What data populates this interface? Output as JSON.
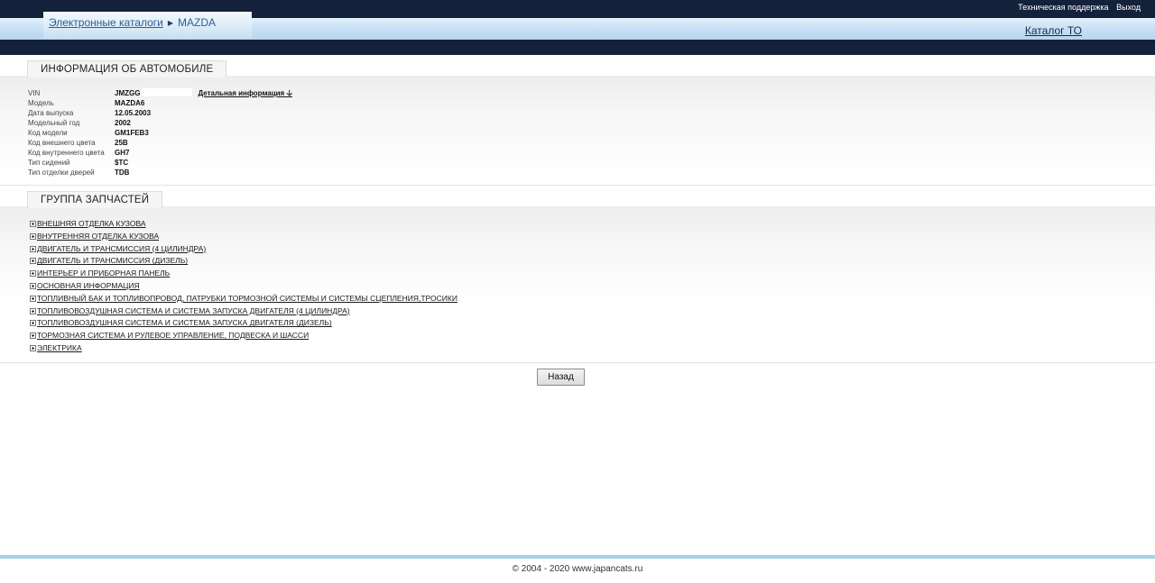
{
  "header": {
    "support_label": "Техническая поддержка",
    "logout_label": "Выход",
    "breadcrumb": {
      "root": "Электронные каталоги",
      "current": "MAZDA"
    },
    "to_catalog_label": "Каталог ТО"
  },
  "vehicle_info": {
    "title": "ИНФОРМАЦИЯ ОБ АВТОМОБИЛЕ",
    "detail_link": "Детальная информация",
    "rows": [
      {
        "label": "VIN",
        "value": "JMZGG"
      },
      {
        "label": "Модель",
        "value": "MAZDA6"
      },
      {
        "label": "Дата выпуска",
        "value": "12.05.2003"
      },
      {
        "label": "Модельный год",
        "value": "2002"
      },
      {
        "label": "Код модели",
        "value": "GM1FEB3"
      },
      {
        "label": "Код внешнего цвета",
        "value": "25B"
      },
      {
        "label": "Код внутреннего цвета",
        "value": "GH7"
      },
      {
        "label": "Тип сидений",
        "value": "$TC"
      },
      {
        "label": "Тип отделки дверей",
        "value": "TDB"
      }
    ]
  },
  "parts_groups": {
    "title": "ГРУППА ЗАПЧАСТЕЙ",
    "items": [
      "ВНЕШНЯЯ ОТДЕЛКА КУЗОВА",
      "ВНУТРЕННЯЯ ОТДЕЛКА КУЗОВА",
      "ДВИГАТЕЛЬ И ТРАНСМИССИЯ (4 ЦИЛИНДРА)",
      "ДВИГАТЕЛЬ И ТРАНСМИССИЯ (ДИЗЕЛЬ)",
      "ИНТЕРЬЕР И ПРИБОРНАЯ ПАНЕЛЬ",
      "ОСНОВНАЯ ИНФОРМАЦИЯ",
      "ТОПЛИВНЫЙ БАК И ТОПЛИВОПРОВОД, ПАТРУБКИ ТОРМОЗНОЙ СИСТЕМЫ И СИСТЕМЫ СЦЕПЛЕНИЯ,ТРОСИКИ",
      "ТОПЛИВОВОЗДУШНАЯ СИСТЕМА И СИСТЕМА ЗАПУСКА ДВИГАТЕЛЯ (4 ЦИЛИНДРА)",
      "ТОПЛИВОВОЗДУШНАЯ СИСТЕМА И СИСТЕМА ЗАПУСКА ДВИГАТЕЛЯ (ДИЗЕЛЬ)",
      "ТОРМОЗНАЯ СИСТЕМА И РУЛЕВОЕ УПРАВЛЕНИЕ, ПОДВЕСКА И ШАССИ",
      "ЭЛЕКТРИКА"
    ]
  },
  "back_button_label": "Назад",
  "footer": {
    "copyright": "© 2004 - 2020 www.japancats.ru"
  }
}
